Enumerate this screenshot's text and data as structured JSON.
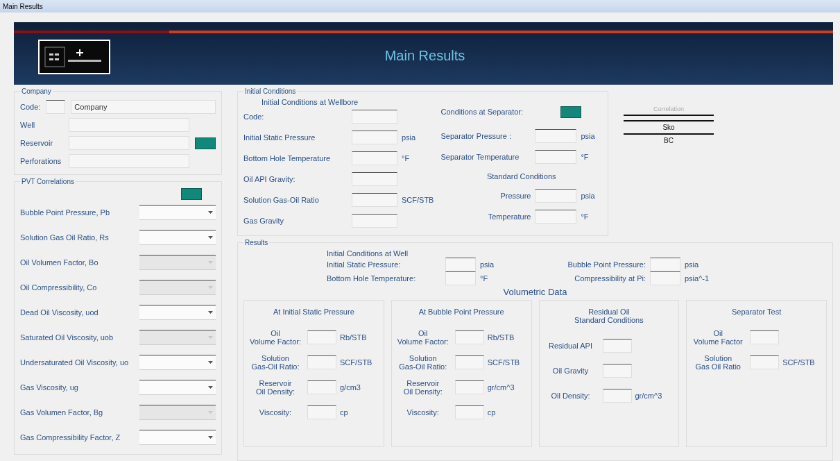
{
  "window": {
    "title": "Main Results"
  },
  "header": {
    "title": "Main Results"
  },
  "company": {
    "title": "Company",
    "code_label": "Code:",
    "company_value": "Company",
    "rows": [
      {
        "label": "Well",
        "kind": "field"
      },
      {
        "label": "Reservoir",
        "kind": "field-button"
      },
      {
        "label": "Perforations",
        "kind": "field"
      }
    ]
  },
  "pvt": {
    "title": "PVT Correlations",
    "rows": [
      {
        "label": "Bubble Point Pressure, Pb",
        "disabled": false
      },
      {
        "label": "Solution Gas Oil Ratio, Rs",
        "disabled": false
      },
      {
        "label": "Oil Volumen Factor, Bo",
        "disabled": true
      },
      {
        "label": "Oil Compressibility, Co",
        "disabled": true
      },
      {
        "label": "Dead Oil Viscosity, uod",
        "disabled": false
      },
      {
        "label": "Saturated Oil Viscosity, uob",
        "disabled": true
      },
      {
        "label": "Undersaturated Oil Viscosity, uo",
        "disabled": false
      },
      {
        "label": "Gas Viscosity, ug",
        "disabled": false
      },
      {
        "label": "Gas Volumen Factor, Bg",
        "disabled": true
      },
      {
        "label": "Gas Compressibility Factor, Z",
        "disabled": false
      }
    ]
  },
  "initial": {
    "title": "Initial Conditions",
    "wellbore_heading": "Initial Conditions at Wellbore",
    "left": [
      {
        "label": "Code:"
      },
      {
        "label": "Initial Static Pressure",
        "unit": "psia"
      },
      {
        "label": "Bottom Hole Temperature",
        "unit": "°F"
      },
      {
        "label": "Oil API Gravity:"
      },
      {
        "label": "Solution Gas-Oil Ratio",
        "unit": "SCF/STB"
      },
      {
        "label": "Gas Gravity"
      }
    ],
    "separator_heading": "Conditions at Separator:",
    "separator": [
      {
        "label": "Separator Pressure :",
        "unit": "psia"
      },
      {
        "label": "Separator Temperature",
        "unit": "°F"
      }
    ],
    "standard_heading": "Standard Conditions",
    "standard": [
      {
        "label": "Pressure",
        "unit": "psia"
      },
      {
        "label": "Temperature",
        "unit": "°F"
      }
    ]
  },
  "side": {
    "caption": "Correlation",
    "values": [
      "Sko",
      "BC"
    ]
  },
  "results": {
    "title": "Results",
    "well_heading": "Initial Conditions at Well",
    "left": [
      {
        "label": "Initial Static Pressure:",
        "unit": "psia"
      },
      {
        "label": "Bottom Hole Temperature:",
        "unit": "°F"
      }
    ],
    "right": [
      {
        "label": "Bubble Point Pressure:",
        "unit": "psia"
      },
      {
        "label": "Compressibility at Pi:",
        "unit": "psia^-1"
      }
    ],
    "volumetric_heading": "Volumetric Data",
    "cards": [
      {
        "title": "At Initial Static Pressure",
        "rows": [
          {
            "label": "Oil\nVolume Factor:",
            "unit": "Rb/STB"
          },
          {
            "label": "Solution\nGas-Oil Ratio:",
            "unit": "SCF/STB"
          },
          {
            "label": "Reservoir\nOil Density:",
            "unit": "g/cm3"
          },
          {
            "label": "Viscosity:",
            "unit": "cp"
          }
        ]
      },
      {
        "title": "At Bubble Point Pressure",
        "rows": [
          {
            "label": "Oil\nVolume Factor:",
            "unit": "Rb/STB"
          },
          {
            "label": "Solution\nGas-Oil Ratio:",
            "unit": "SCF/STB"
          },
          {
            "label": "Reservoir\nOil Density:",
            "unit": "gr/cm^3"
          },
          {
            "label": "Viscosity:",
            "unit": "cp"
          }
        ]
      },
      {
        "title": "Residual Oil\nStandard Conditions",
        "rows": [
          {
            "label": "Residual API"
          },
          {
            "label": "Oil Gravity"
          },
          {
            "label": "Oil Density:",
            "unit": "gr/cm^3"
          }
        ]
      },
      {
        "title": "Separator Test",
        "rows": [
          {
            "label": "Oil\nVolume Factor"
          },
          {
            "label": "Solution\nGas Oil Ratio",
            "unit": "SCF/STB"
          }
        ]
      }
    ]
  }
}
